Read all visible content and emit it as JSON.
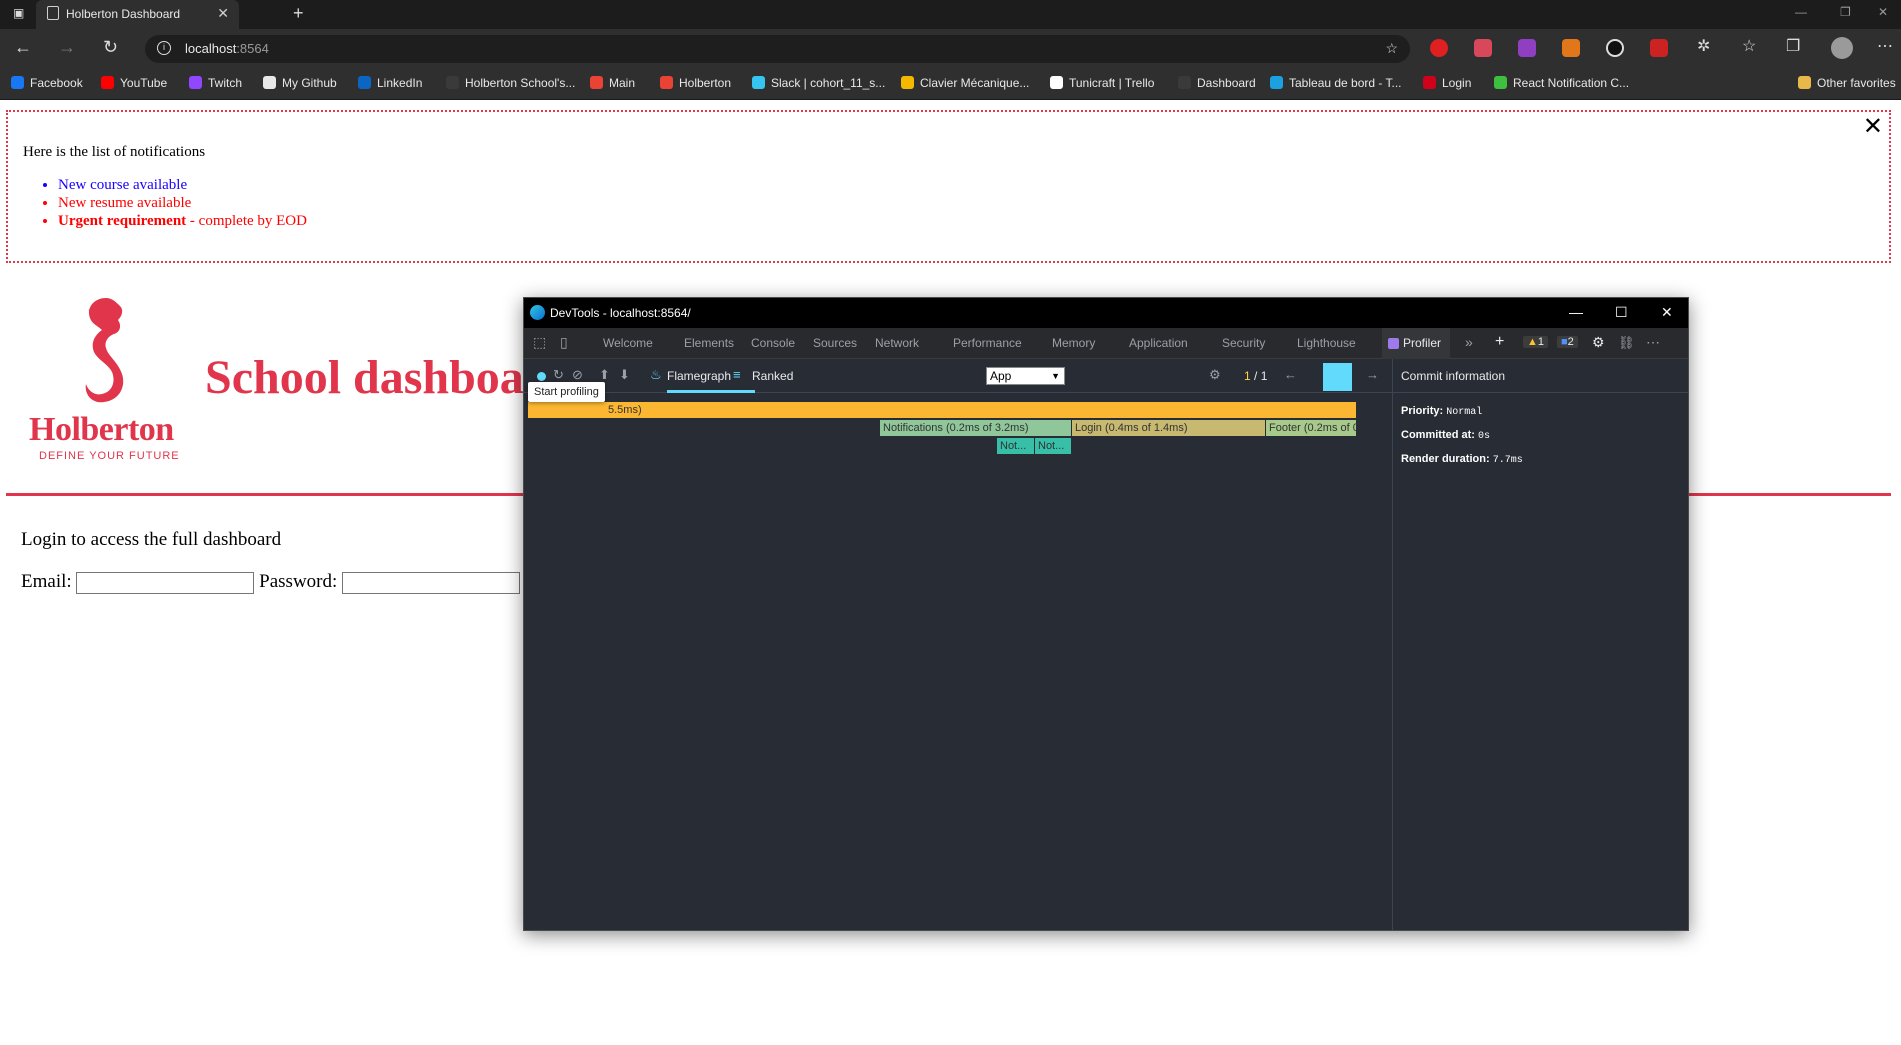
{
  "browser": {
    "tab_title": "Holberton Dashboard",
    "url_host": "localhost",
    "url_port": ":8564",
    "bookmarks": [
      {
        "label": "Facebook",
        "color": "#1877f2"
      },
      {
        "label": "YouTube",
        "color": "#ff0000"
      },
      {
        "label": "Twitch",
        "color": "#9146ff"
      },
      {
        "label": "My Github",
        "color": "#e8e8e8"
      },
      {
        "label": "LinkedIn",
        "color": "#0a66c2"
      },
      {
        "label": "Holberton School's...",
        "color": "#3a3a3a"
      },
      {
        "label": "Main",
        "color": "#ea4335"
      },
      {
        "label": "Holberton",
        "color": "#ea4335"
      },
      {
        "label": "Slack | cohort_11_s...",
        "color": "#36c5f0"
      },
      {
        "label": "Clavier Mécanique...",
        "color": "#f5b800"
      },
      {
        "label": "Tunicraft | Trello",
        "color": "#ffffff"
      },
      {
        "label": "Dashboard",
        "color": "#3a3a3a"
      },
      {
        "label": "Tableau de bord - T...",
        "color": "#1ba1e2"
      },
      {
        "label": "Login",
        "color": "#d0021b"
      },
      {
        "label": "React Notification C...",
        "color": "#3fbf3f"
      }
    ],
    "other_favorites": "Other favorites"
  },
  "notifications": {
    "title": "Here is the list of notifications",
    "items": [
      {
        "text": "New course available",
        "type": "default"
      },
      {
        "text": "New resume available",
        "type": "urgent"
      }
    ],
    "urgent_bold": "Urgent requirement",
    "urgent_rest": " - complete by EOD",
    "close": "✕"
  },
  "header": {
    "logo_name": "Holberton",
    "logo_tagline": "DEFINE YOUR FUTURE",
    "title": "School dashboard"
  },
  "login": {
    "prompt": "Login to access the full dashboard",
    "email_label": "Email:",
    "password_label": "Password:"
  },
  "devtools": {
    "window_title": "DevTools - localhost:8564/",
    "tabs": [
      "Welcome",
      "Elements",
      "Console",
      "Sources",
      "Network",
      "Performance",
      "Memory",
      "Application",
      "Security",
      "Lighthouse"
    ],
    "active_tab": "Profiler",
    "warnings": "1",
    "messages": "2",
    "view_flamegraph": "Flamegraph",
    "view_ranked": "Ranked",
    "root_select": "App",
    "commit_current": "1",
    "commit_sep": "/",
    "commit_total": "1",
    "tooltip": "Start profiling",
    "flame_root": "5.5ms)",
    "flame_bars": [
      {
        "label": "Notifications (0.2ms of 3.2ms)",
        "color": "#8fc79a"
      },
      {
        "label": "Login (0.4ms of 1.4ms)",
        "color": "#c7b970"
      },
      {
        "label": "Footer (0.2ms of 0...",
        "color": "#a7c98a"
      },
      {
        "label": "Not...",
        "color": "#37bfa7"
      },
      {
        "label": "Not...",
        "color": "#37bfa7"
      }
    ],
    "commit_info": {
      "heading": "Commit information",
      "priority_label": "Priority:",
      "priority_value": "Normal",
      "committed_label": "Committed at:",
      "committed_value": "0s",
      "duration_label": "Render duration:",
      "duration_value": "7.7ms"
    }
  },
  "colors": {
    "brand": "#e0354b",
    "react_blue": "#61dafb",
    "flame_root": "#fbb731"
  }
}
